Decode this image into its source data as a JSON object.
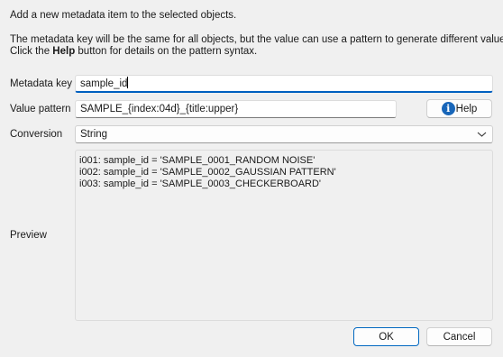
{
  "intro": {
    "line1": "Add a new metadata item to the selected objects.",
    "line2": "The metadata key will be the same for all objects, but the value can use a pattern to generate different values.",
    "line3_prefix": "Click the ",
    "line3_bold": "Help",
    "line3_suffix": " button for details on the pattern syntax."
  },
  "form": {
    "metadata_key_label": "Metadata key",
    "metadata_key_value": "sample_id",
    "value_pattern_label": "Value pattern",
    "value_pattern_value": "SAMPLE_{index:04d}_{title:upper}",
    "help_button_label": "Help",
    "help_icon": "info-icon",
    "conversion_label": "Conversion",
    "conversion_value": "String",
    "preview_label": "Preview",
    "preview_lines": [
      "i001: sample_id = 'SAMPLE_0001_RANDOM NOISE'",
      "i002: sample_id = 'SAMPLE_0002_GAUSSIAN PATTERN'",
      "i003: sample_id = 'SAMPLE_0003_CHECKERBOARD'"
    ]
  },
  "buttons": {
    "ok": "OK",
    "cancel": "Cancel"
  },
  "colors": {
    "background": "#f0f0f0",
    "accent": "#0067c0",
    "info_icon": "#1866b9"
  }
}
